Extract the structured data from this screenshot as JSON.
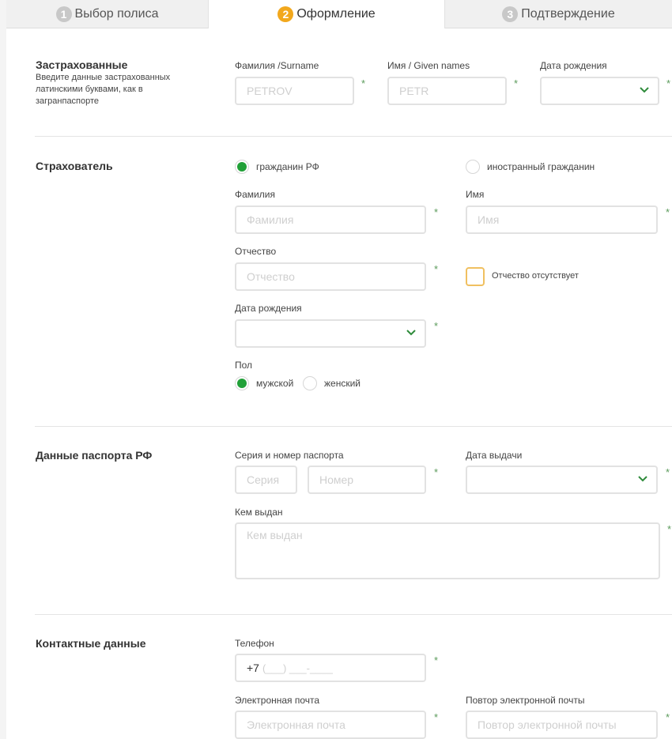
{
  "tabs": [
    {
      "num": "1",
      "label": "Выбор полиса",
      "active": false
    },
    {
      "num": "2",
      "label": "Оформление",
      "active": true
    },
    {
      "num": "3",
      "label": "Подтверждение",
      "active": false
    }
  ],
  "insured": {
    "title": "Застрахованные",
    "description": "Введите данные застрахованных латинскими буквами, как в загранпаспорте",
    "surname_label": "Фамилия /Surname",
    "surname_placeholder": "PETROV",
    "given_label": "Имя / Given names",
    "given_placeholder": "PETR",
    "birth_label": "Дата рождения",
    "birth_value": ""
  },
  "policyholder": {
    "title": "Страхователь",
    "citizen_rf": "гражданин РФ",
    "foreign": "иностранный гражданин",
    "citizenship_selected": "гражданин РФ",
    "surname_label": "Фамилия",
    "surname_placeholder": "Фамилия",
    "name_label": "Имя",
    "name_placeholder": "Имя",
    "patronymic_label": "Отчество",
    "patronymic_placeholder": "Отчество",
    "no_patronymic": "Отчество отсутствует",
    "no_patronymic_checked": false,
    "birth_label": "Дата рождения",
    "birth_value": "",
    "gender_label": "Пол",
    "male": "мужской",
    "female": "женский",
    "gender_selected": "мужской"
  },
  "passport": {
    "title": "Данные паспорта РФ",
    "series_number_label": "Серия и номер паспорта",
    "series_placeholder": "Серия",
    "number_placeholder": "Номер",
    "issue_date_label": "Дата выдачи",
    "issue_date_value": "",
    "issued_by_label": "Кем выдан",
    "issued_by_placeholder": "Кем выдан"
  },
  "contacts": {
    "title": "Контактные данные",
    "phone_label": "Телефон",
    "phone_prefix": "+7",
    "phone_mask": "(___) ___-____",
    "email_label": "Электронная почта",
    "email_placeholder": "Электронная почта",
    "email_repeat_label": "Повтор электронной почты",
    "email_repeat_placeholder": "Повтор электронной почты"
  },
  "required_mark": "*",
  "colors": {
    "accent_green": "#21a038",
    "step_active": "#f2a81d",
    "checkbox_border": "#f0c060"
  }
}
